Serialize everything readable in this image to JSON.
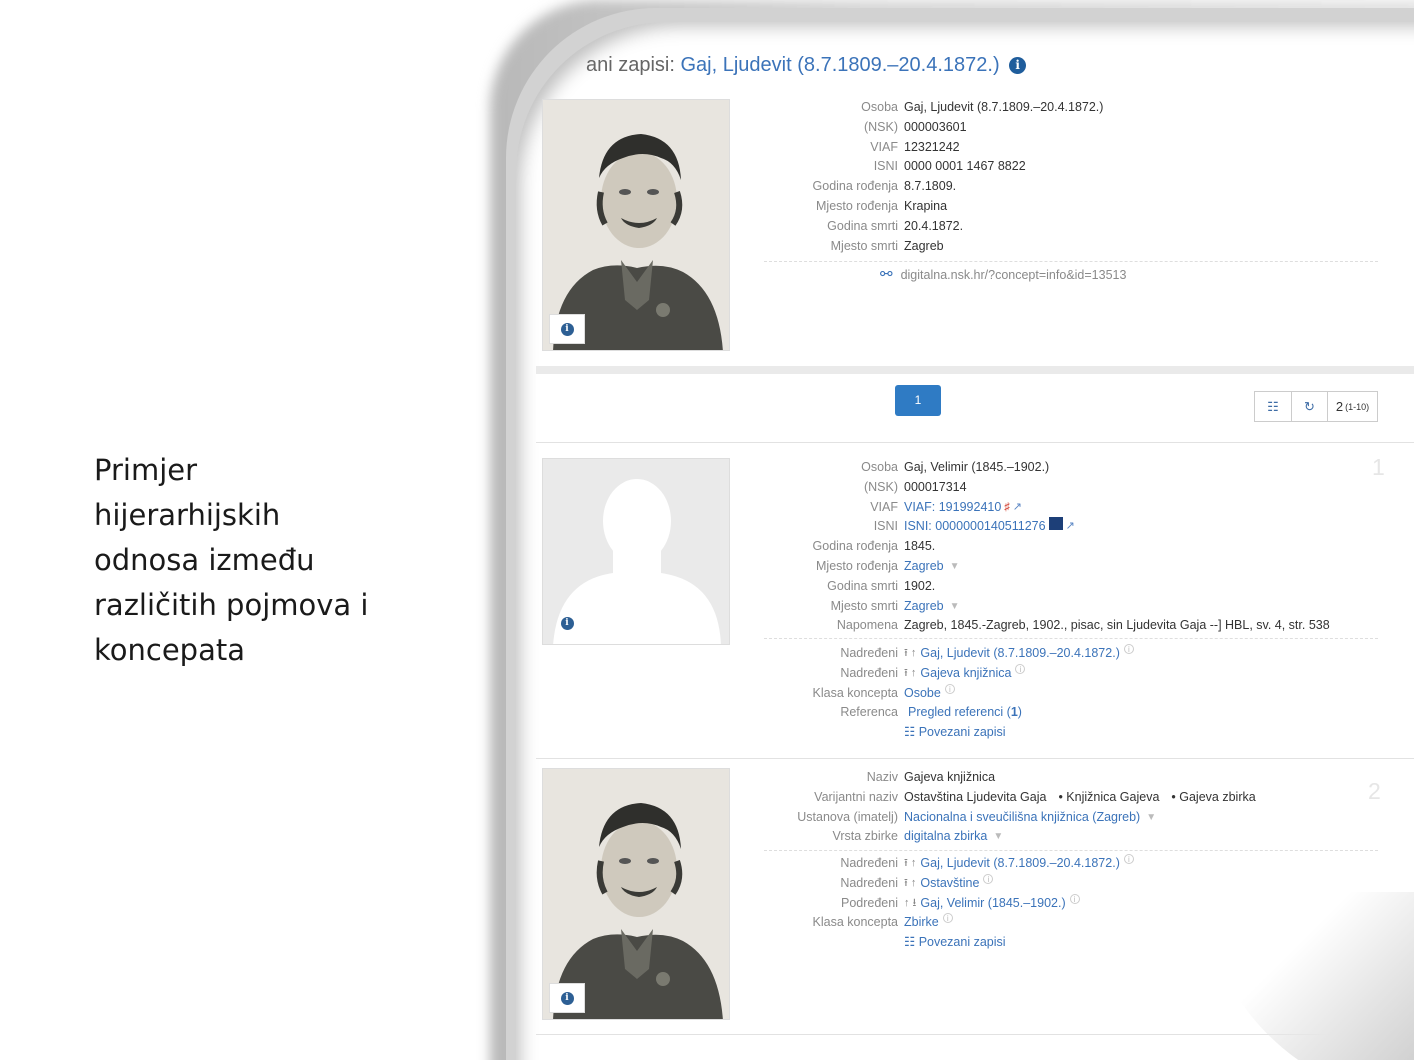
{
  "caption": {
    "line1": "Primjer",
    "line2": "hijerarhijskih",
    "line3": "odnosa između",
    "line4": "različitih pojmova i",
    "line5": "koncepata"
  },
  "header": {
    "prefix": "ani zapisi: ",
    "title": "Gaj, Ljudevit (8.7.1809.–20.4.1872.)",
    "info": "i"
  },
  "top_record": {
    "fields": [
      {
        "label": "Osoba",
        "value": "Gaj, Ljudevit (8.7.1809.–20.4.1872.)"
      },
      {
        "label": "(NSK)",
        "value": "000003601"
      },
      {
        "label": "VIAF",
        "value": "12321242"
      },
      {
        "label": "ISNI",
        "value": "0000 0001 1467 8822"
      },
      {
        "label": "Godina rođenja",
        "value": "8.7.1809."
      },
      {
        "label": "Mjesto rođenja",
        "value": "Krapina"
      },
      {
        "label": "Godina smrti",
        "value": "20.4.1872."
      },
      {
        "label": "Mjesto smrti",
        "value": "Zagreb"
      }
    ],
    "link": "digitalna.nsk.hr/?concept=info&id=13513"
  },
  "pager": {
    "current_page": "1",
    "count": "2",
    "range": "(1-10)"
  },
  "results": [
    {
      "number": "1",
      "fields": [
        {
          "label": "Osoba",
          "value": "Gaj, Velimir (1845.–1902.)"
        },
        {
          "label": "(NSK)",
          "value": "000017314"
        },
        {
          "label": "VIAF",
          "value": "VIAF: 191992410"
        },
        {
          "label": "ISNI",
          "value": "ISNI: 0000000140511276"
        },
        {
          "label": "Godina rođenja",
          "value": "1845."
        },
        {
          "label": "Mjesto rođenja",
          "value": "Zagreb"
        },
        {
          "label": "Godina smrti",
          "value": "1902."
        },
        {
          "label": "Mjesto smrti",
          "value": "Zagreb"
        },
        {
          "label": "Napomena",
          "value": "Zagreb, 1845.-Zagreb, 1902., pisac, sin Ljudevita Gaja --] HBL, sv. 4, str. 538"
        }
      ],
      "relations": [
        {
          "label": "Nadređeni",
          "value": "Gaj, Ljudevit (8.7.1809.–20.4.1872.)"
        },
        {
          "label": "Nadređeni",
          "value": "Gajeva knjižnica"
        },
        {
          "label": "Klasa koncepta",
          "value": "Osobe"
        },
        {
          "label": "Referenca",
          "value": "Pregled referenci (",
          "count": "1",
          "suffix": ")"
        }
      ],
      "linked": "Povezani zapisi"
    },
    {
      "number": "2",
      "fields": [
        {
          "label": "Naziv",
          "value": "Gajeva knjižnica"
        },
        {
          "label": "Varijantni naziv",
          "values": [
            "Ostavština Ljudevita Gaja",
            "• Knjižnica Gajeva",
            "• Gajeva zbirka"
          ]
        },
        {
          "label": "Ustanova (imatelj)",
          "value": "Nacionalna i sveučilišna knjižnica (Zagreb)"
        },
        {
          "label": "Vrsta zbirke",
          "value": "digitalna zbirka"
        }
      ],
      "relations": [
        {
          "label": "Nadređeni",
          "value": "Gaj, Ljudevit (8.7.1809.–20.4.1872.)"
        },
        {
          "label": "Nadređeni",
          "value": "Ostavštine"
        },
        {
          "label": "Podređeni",
          "value": "Gaj, Velimir (1845.–1902.)"
        },
        {
          "label": "Klasa koncepta",
          "value": "Zbirke"
        }
      ],
      "linked": "Povezani zapisi"
    }
  ]
}
